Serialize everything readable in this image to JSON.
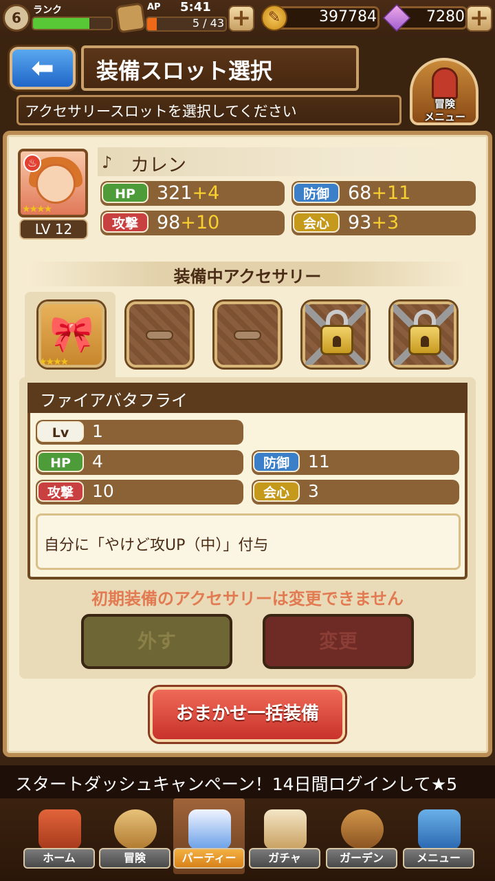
{
  "status": {
    "rank_label": "ランク",
    "rank_level": "6",
    "rank_progress": 0.72,
    "ap_label": "AP",
    "time": "5:41",
    "ap_value": "5 / 43",
    "ap_progress": 0.12,
    "gold": "397784",
    "gems": "7280"
  },
  "header": {
    "title": "装備スロット選択",
    "subtitle": "アクセサリースロットを選択してください",
    "adventure_menu": "冒険\nメニュー"
  },
  "character": {
    "name": "カレン",
    "level": "LV 12",
    "stars": "★★★★",
    "stats": {
      "hp_label": "HP",
      "hp_base": "321",
      "hp_bonus": "+4",
      "def_label": "防御",
      "def_base": "68",
      "def_bonus": "+11",
      "atk_label": "攻撃",
      "atk_base": "98",
      "atk_bonus": "+10",
      "crit_label": "会心",
      "crit_base": "93",
      "crit_bonus": "+3"
    }
  },
  "section_title": "装備中アクセサリー",
  "slots": {
    "selected_stars": "★★★★"
  },
  "accessory": {
    "name": "ファイアバタフライ",
    "lv_label": "Lv",
    "lv": "1",
    "hp_label": "HP",
    "hp": "4",
    "def_label": "防御",
    "def": "11",
    "atk_label": "攻撃",
    "atk": "10",
    "crit_label": "会心",
    "crit": "3",
    "description": "自分に「やけど攻UP（中）」付与"
  },
  "warning": "初期装備のアクセサリーは変更できません",
  "buttons": {
    "remove": "外す",
    "change": "変更",
    "auto_equip": "おまかせ一括装備"
  },
  "ticker": "スタートダッシュキャンペーン！14日間ログインして★5",
  "nav": {
    "home": "ホーム",
    "adventure": "冒険",
    "party": "パーティー",
    "gacha": "ガチャ",
    "garden": "ガーデン",
    "menu": "メニュー"
  }
}
